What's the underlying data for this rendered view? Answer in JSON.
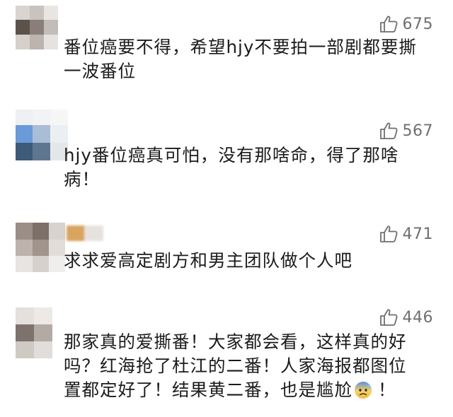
{
  "comments": [
    {
      "likes": "675",
      "lines": [
        "番位癌要不得，希望hjy不要拍一部剧都要撕",
        "一波番位"
      ]
    },
    {
      "likes": "567",
      "lines": [
        "hjy番位癌真可怕，没有那啥命，得了那啥",
        "病！"
      ]
    },
    {
      "likes": "471",
      "lines": [
        "求求爱高定剧方和男主团队做个人吧"
      ]
    },
    {
      "likes": "446",
      "lines": [
        "那家真的爱撕番！大家都会看，这样真的好",
        "吗？红海抢了杜江的二番！人家海报都图位",
        "置都定好了！结果黄二番，也是尴尬"
      ],
      "line_end": "！",
      "emoji": "anxious-sweat-face"
    }
  ],
  "icons": {
    "like": "thumbs-up-icon"
  },
  "colors": {
    "text": "#1a1a1a",
    "like_count": "#6f6f6f",
    "background": "#ffffff"
  }
}
